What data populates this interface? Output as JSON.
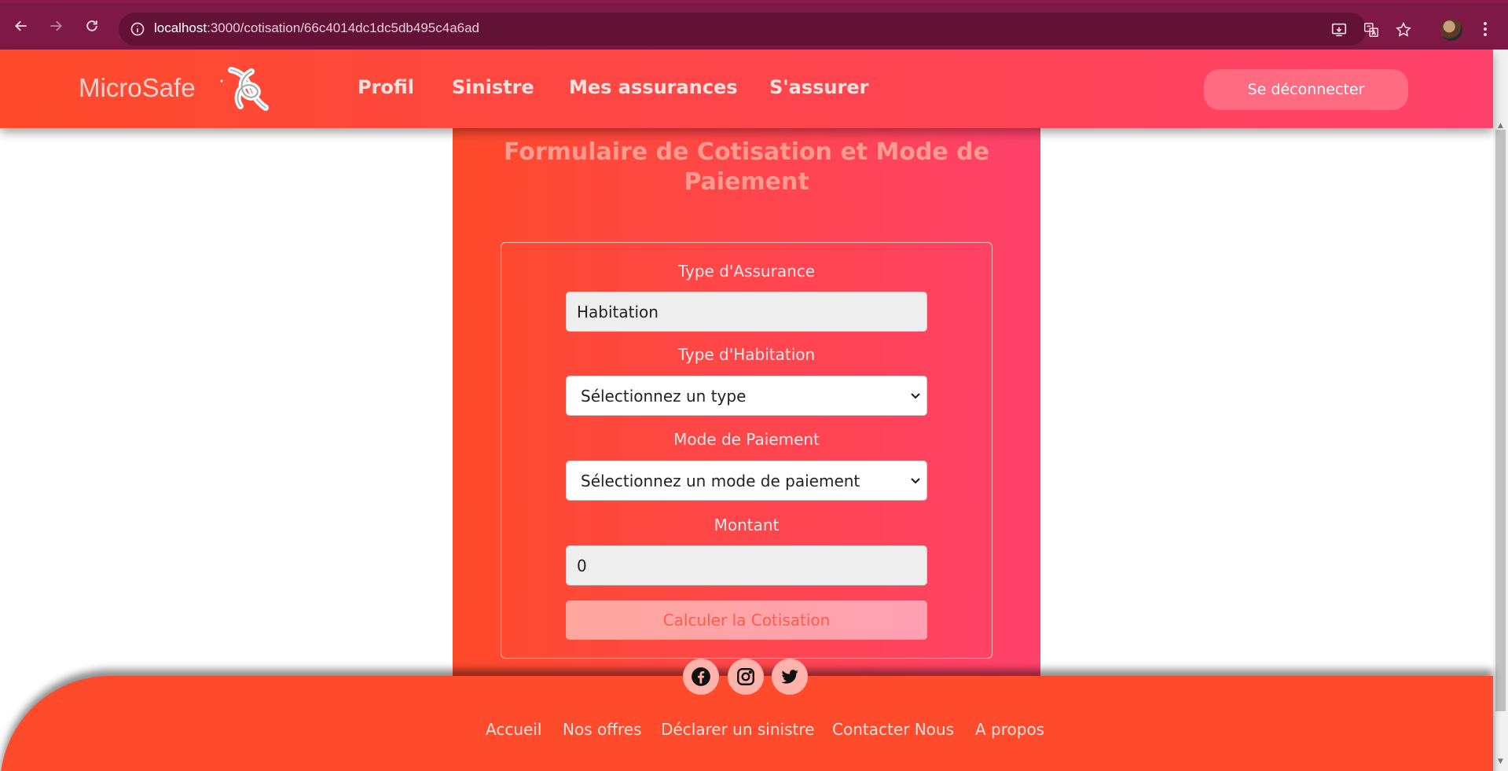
{
  "browser": {
    "url_host": "localhost",
    "url_path": ":3000/cotisation/66c4014dc1dc5db495c4a6ad"
  },
  "header": {
    "brand": "MicroSafe",
    "nav": [
      {
        "label": "Profil"
      },
      {
        "label": "Sinistre"
      },
      {
        "label": "Mes assurances"
      },
      {
        "label": "S'assurer"
      }
    ],
    "logout_label": "Se déconnecter"
  },
  "form": {
    "title": "Formulaire de Cotisation et Mode de Paiement",
    "insurance_type_label": "Type d'Assurance",
    "insurance_type_value": "Habitation",
    "housing_type_label": "Type d'Habitation",
    "housing_type_selected": "Sélectionnez un type",
    "payment_mode_label": "Mode de Paiement",
    "payment_mode_selected": "Sélectionnez un mode de paiement",
    "amount_label": "Montant",
    "amount_value": "0",
    "calculate_label": "Calculer la Cotisation"
  },
  "footer": {
    "social": [
      "facebook-icon",
      "instagram-icon",
      "twitter-icon"
    ],
    "links": [
      {
        "label": "Accueil"
      },
      {
        "label": "Nos offres"
      },
      {
        "label": "Déclarer un sinistre"
      },
      {
        "label": "Contacter Nous"
      },
      {
        "label": "A propos"
      }
    ]
  },
  "colors": {
    "brand_gradient_start": "#ff4b2b",
    "brand_gradient_end": "#ff416c",
    "browser_chrome": "#7e1845"
  }
}
